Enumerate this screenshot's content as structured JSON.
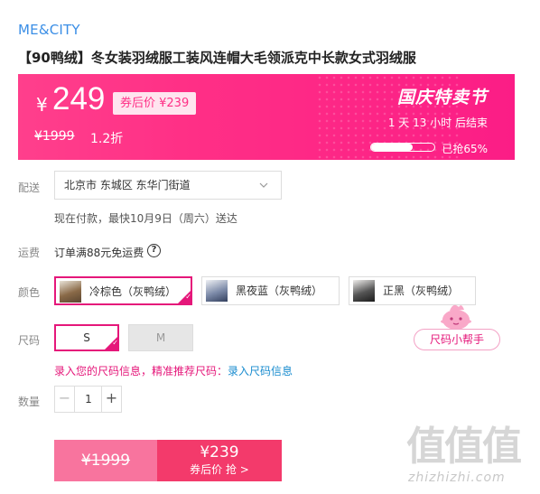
{
  "brand": "ME&CITY",
  "title": "【90鸭绒】冬女装羽绒服工装风连帽大毛领派克中长款女式羽绒服",
  "promo": {
    "currency": "¥",
    "price": "249",
    "coupon_price": "券后价 ¥239",
    "original_price": "¥1999",
    "discount": "1.2折",
    "festival": "国庆特卖节",
    "countdown": "1 天 13 小时 后结束",
    "sold_text": "已抢65%",
    "sold_fraction": 0.65
  },
  "delivery": {
    "label": "配送",
    "location": "北京市 东城区 东华门街道",
    "eta": "现在付款，最快10月9日（周六）送达"
  },
  "shipping": {
    "label": "运费",
    "text": "订单满88元免运费",
    "help_icon": "?"
  },
  "color": {
    "label": "颜色",
    "options": [
      {
        "name": "冷棕色（灰鸭绒）",
        "selected": true
      },
      {
        "name": "黑夜蓝（灰鸭绒）",
        "selected": false
      },
      {
        "name": "正黑（灰鸭绒）",
        "selected": false
      }
    ]
  },
  "size": {
    "label": "尺码",
    "options": [
      {
        "name": "S",
        "selected": true
      },
      {
        "name": "M",
        "selected": false,
        "disabled": true
      }
    ],
    "helper_button": "尺码小帮手",
    "tip_text": "录入您的尺码信息，精准推荐尺码：",
    "tip_link": "录入尺码信息"
  },
  "quantity": {
    "label": "数量",
    "minus": "−",
    "value": "1",
    "plus": "+"
  },
  "buy": {
    "original": "¥1999",
    "price": "¥239",
    "cta": "券后价 抢 >"
  },
  "watermark": {
    "mark": "值值值",
    "url": "zhizhizhi.com"
  },
  "colors": {
    "accent": "#e5177a",
    "banner": "#ff2f86",
    "link": "#1a8ccf",
    "brand": "#3a8ee6"
  }
}
